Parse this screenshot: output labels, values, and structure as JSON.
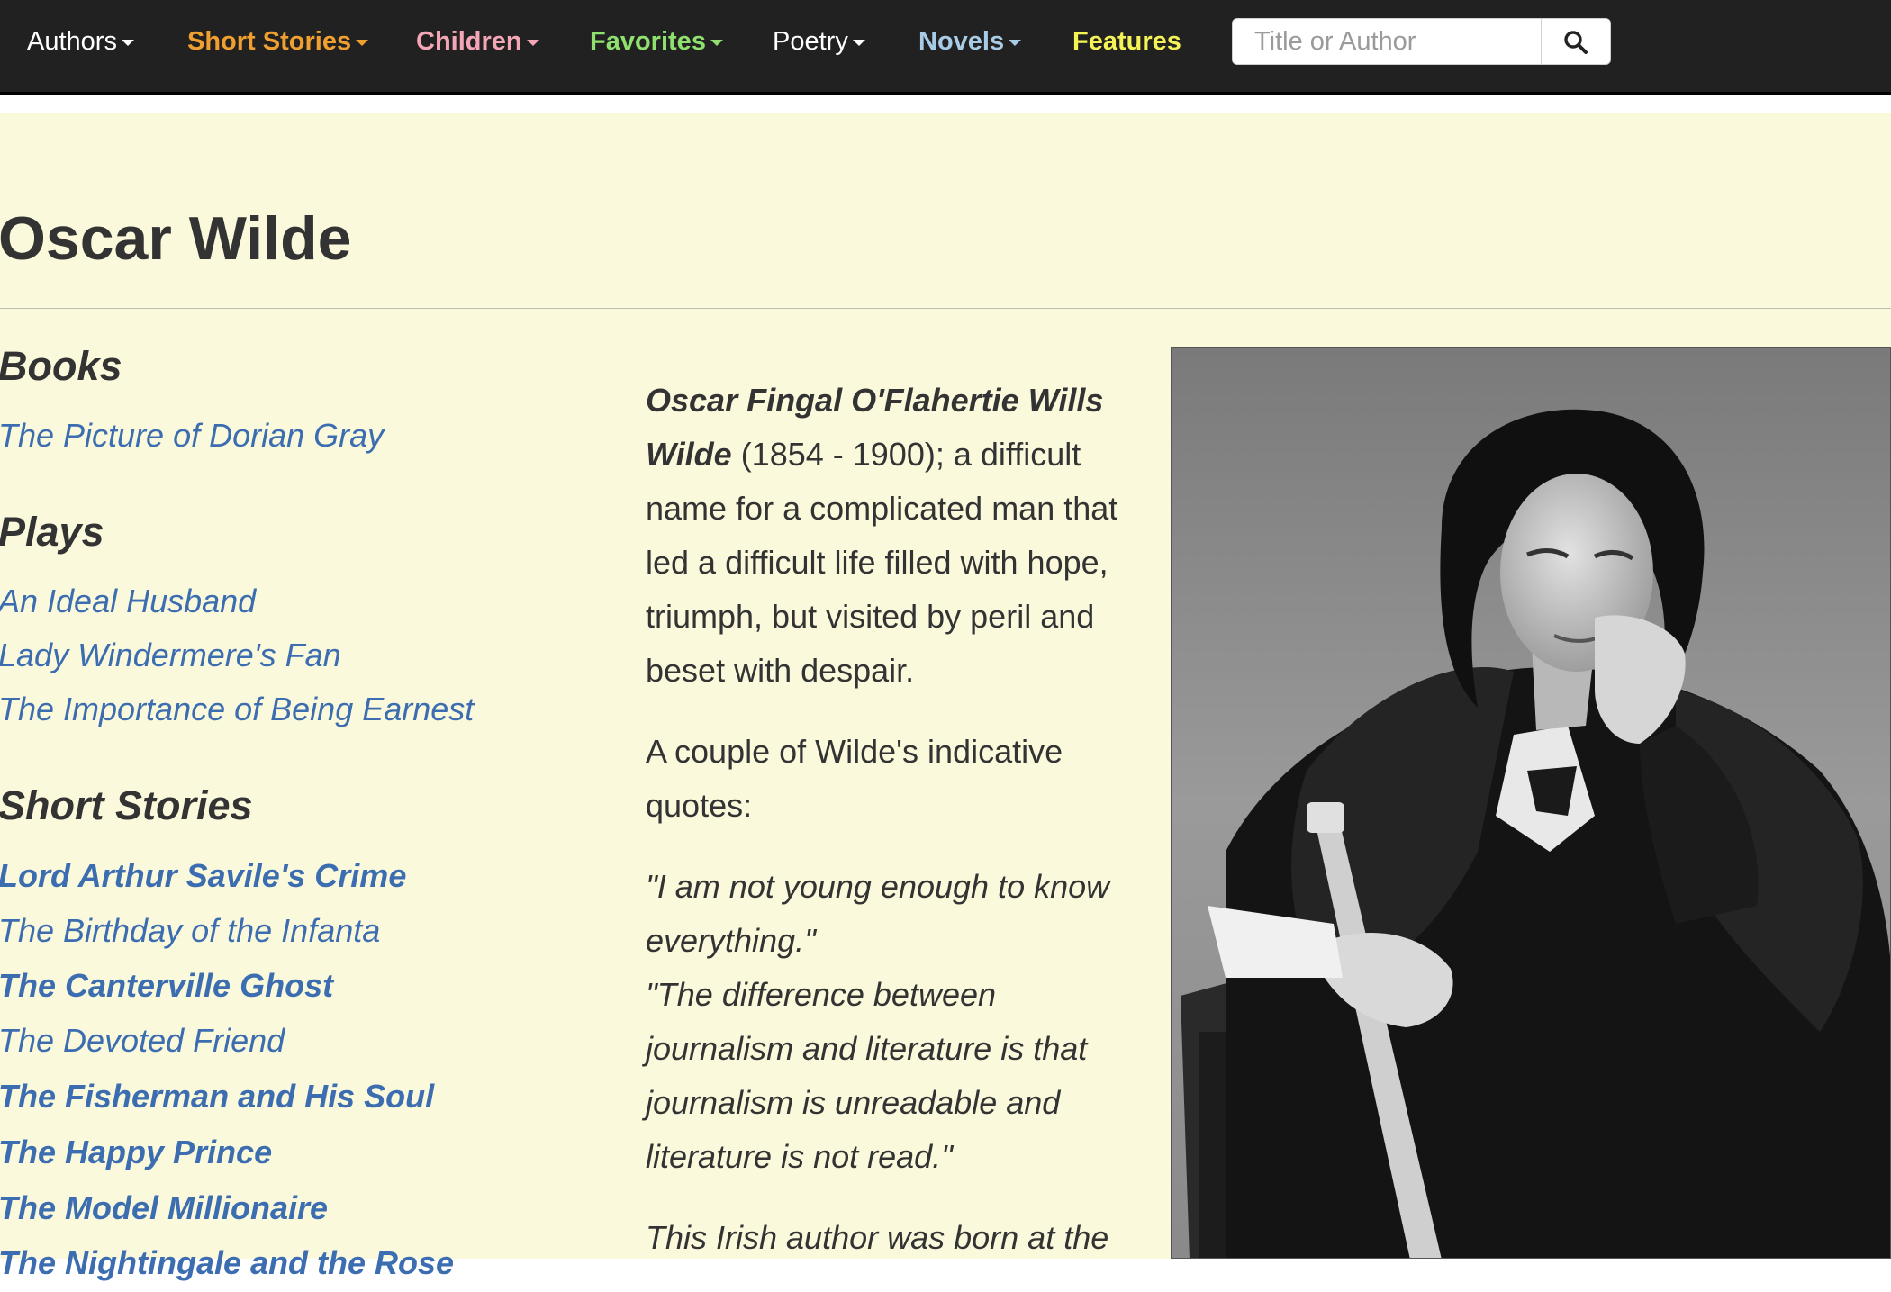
{
  "nav": {
    "authors": "Authors",
    "short_stories": "Short Stories",
    "children": "Children",
    "favorites": "Favorites",
    "poetry": "Poetry",
    "novels": "Novels",
    "features": "Features",
    "search_placeholder": "Title or Author",
    "search_value": ""
  },
  "page": {
    "title": "Oscar Wilde"
  },
  "sections": {
    "books": {
      "heading": "Books",
      "items": [
        "The Picture of Dorian Gray"
      ]
    },
    "plays": {
      "heading": "Plays",
      "items": [
        "An Ideal Husband",
        "Lady Windermere's Fan",
        "The Importance of Being Earnest"
      ]
    },
    "short_stories": {
      "heading": "Short Stories",
      "items": [
        "Lord Arthur Savile's Crime",
        "The Birthday of the Infanta",
        "The Canterville Ghost",
        "The Devoted Friend",
        "The Fisherman and His Soul",
        "The Happy Prince",
        "The Model Millionaire",
        "The Nightingale and the Rose"
      ]
    }
  },
  "bio": {
    "full_name": "Oscar Fingal O'Flahertie Wills Wilde",
    "intro": " (1854 - 1900); a difficult name for a complicated man that led a difficult life filled with hope, triumph, but visited by peril and beset with despair.",
    "quotes_intro": "A couple of Wilde's indicative quotes:",
    "quote_1": "\"I am not young enough to know everything.\"",
    "quote_2": "\"The difference between journalism and literature is that journalism is unreadable and literature is not read.\"",
    "continued": "This Irish author was born at the"
  },
  "colors": {
    "navbar_bg": "#212121",
    "content_bg": "#fbf9dc",
    "link": "#3b6db0",
    "nav_short_stories": "#f0a030",
    "nav_children": "#f4a6b7",
    "nav_favorites": "#8fe06e",
    "nav_novels": "#a8cbe6",
    "nav_features": "#f5f255"
  },
  "icons": {
    "search": "search-icon",
    "caret": "caret-down-icon"
  }
}
